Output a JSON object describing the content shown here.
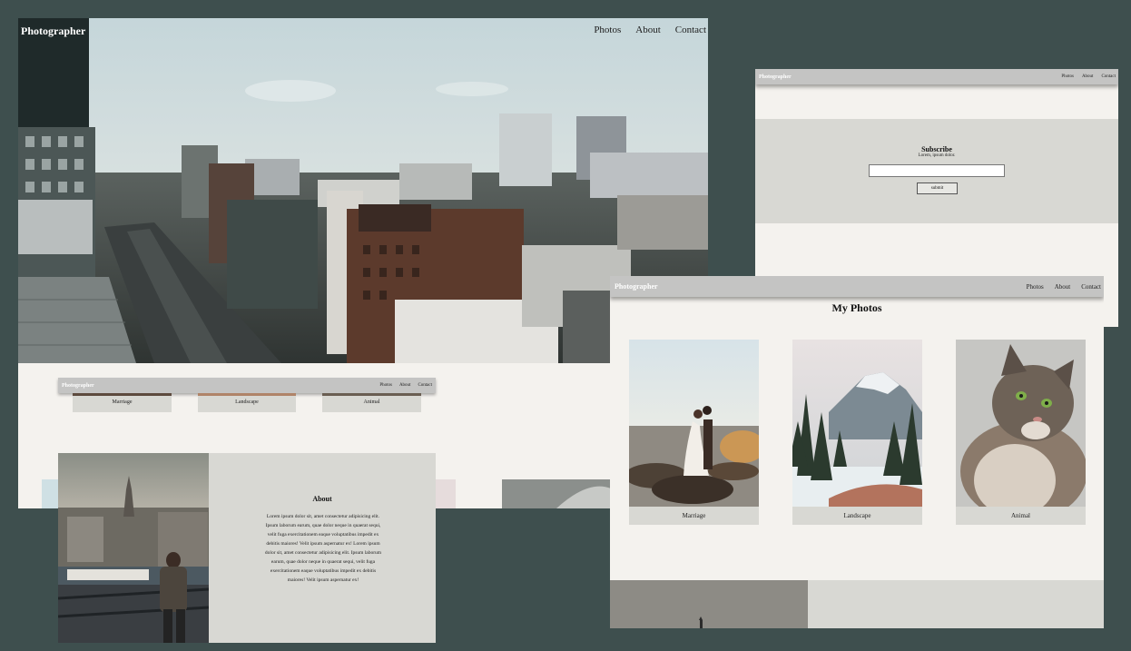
{
  "site": {
    "brand": "Photographer"
  },
  "nav": {
    "photos": "Photos",
    "about": "About",
    "contact": "Contact"
  },
  "gallery": {
    "heading": "My Photos",
    "items": [
      {
        "label": "Marriage"
      },
      {
        "label": "Landscape"
      },
      {
        "label": "Animal"
      }
    ]
  },
  "about": {
    "heading": "About",
    "body": "Lorem ipsum dolor sit, amet consectetur adipisicing elit. Ipsum laborum earum, quae dolor neque in quaerat sequi, velit fuga exercitationem eaque voluptatibus impedit ex debitis maiores! Velit ipsum aspernatur ex! Lorem ipsum dolor sit, amet consectetur adipisicing elit. Ipsum laborum earum, quae dolor neque in quaerat sequi, velit fuga exercitationem eaque voluptatibus impedit ex debitis maiores! Velit ipsum aspernatur ex!"
  },
  "subscribe": {
    "heading": "Subscribe",
    "subtext": "Lorem, ipsum dolor.",
    "input_value": "",
    "button": "submit"
  },
  "colors": {
    "background": "#3e4f4e",
    "page": "#f4f2ee",
    "nav": "#c4c4c3",
    "card": "#d8d8d3"
  }
}
